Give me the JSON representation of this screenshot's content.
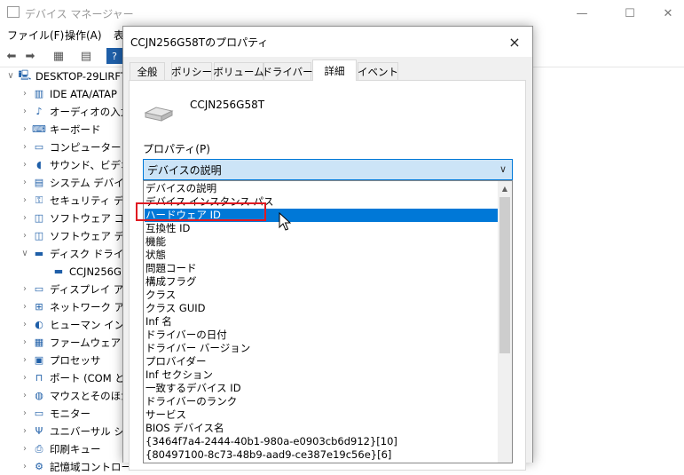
{
  "main_window": {
    "title": "デバイス マネージャー",
    "menu": [
      "ファイル(F)",
      "操作(A)",
      "表"
    ],
    "tree": [
      {
        "label": "DESKTOP-29LIRFT",
        "indent": 0,
        "expander": "v",
        "icon": "computer-icon"
      },
      {
        "label": "IDE ATA/ATAP",
        "indent": 1,
        "expander": ">",
        "icon": "ide-controller-icon"
      },
      {
        "label": "オーディオの入力",
        "indent": 1,
        "expander": ">",
        "icon": "audio-icon"
      },
      {
        "label": "キーボード",
        "indent": 1,
        "expander": ">",
        "icon": "keyboard-icon"
      },
      {
        "label": "コンピューター",
        "indent": 1,
        "expander": ">",
        "icon": "monitor-icon"
      },
      {
        "label": "サウンド、ビデオ、",
        "indent": 1,
        "expander": ">",
        "icon": "speaker-icon"
      },
      {
        "label": "システム デバイス",
        "indent": 1,
        "expander": ">",
        "icon": "system-device-icon"
      },
      {
        "label": "セキュリティ デバイ",
        "indent": 1,
        "expander": ">",
        "icon": "security-key-icon"
      },
      {
        "label": "ソフトウェア コンポ",
        "indent": 1,
        "expander": ">",
        "icon": "software-component-icon"
      },
      {
        "label": "ソフトウェア デバ",
        "indent": 1,
        "expander": ">",
        "icon": "software-device-icon"
      },
      {
        "label": "ディスク ドライブ",
        "indent": 1,
        "expander": "v",
        "icon": "disk-drive-icon"
      },
      {
        "label": "CCJN256G",
        "indent": 2,
        "expander": "",
        "icon": "disk-drive-icon"
      },
      {
        "label": "ディスプレイ アダ",
        "indent": 1,
        "expander": ">",
        "icon": "display-adapter-icon"
      },
      {
        "label": "ネットワーク アダ",
        "indent": 1,
        "expander": ">",
        "icon": "network-adapter-icon"
      },
      {
        "label": "ヒューマン インタ",
        "indent": 1,
        "expander": ">",
        "icon": "hid-icon"
      },
      {
        "label": "ファームウェア",
        "indent": 1,
        "expander": ">",
        "icon": "firmware-icon"
      },
      {
        "label": "プロセッサ",
        "indent": 1,
        "expander": ">",
        "icon": "processor-icon"
      },
      {
        "label": "ポート (COM と",
        "indent": 1,
        "expander": ">",
        "icon": "port-icon"
      },
      {
        "label": "マウスとそのほか",
        "indent": 1,
        "expander": ">",
        "icon": "mouse-icon"
      },
      {
        "label": "モニター",
        "indent": 1,
        "expander": ">",
        "icon": "monitor-icon"
      },
      {
        "label": "ユニバーサル シリ",
        "indent": 1,
        "expander": ">",
        "icon": "usb-icon"
      },
      {
        "label": "印刷キュー",
        "indent": 1,
        "expander": ">",
        "icon": "printer-icon"
      },
      {
        "label": "記憶域コントロー",
        "indent": 1,
        "expander": ">",
        "icon": "storage-controller-icon"
      }
    ]
  },
  "dialog": {
    "title": "CCJN256G58Tのプロパティ",
    "close_icon": "×",
    "tabs": [
      "全般",
      "ポリシー",
      "ボリューム",
      "ドライバー",
      "詳細",
      "イベント"
    ],
    "active_tab": "詳細",
    "device_name": "CCJN256G58T",
    "property_label": "プロパティ(P)",
    "property_selected": "デバイスの説明",
    "property_options": [
      "デバイスの説明",
      "デバイス インスタンス パス",
      "ハードウェア ID",
      "互換性 ID",
      "機能",
      "状態",
      "問題コード",
      "構成フラグ",
      "クラス",
      "クラス GUID",
      "Inf 名",
      "ドライバーの日付",
      "ドライバー バージョン",
      "プロバイダー",
      "Inf セクション",
      "一致するデバイス ID",
      "ドライバーのランク",
      "サービス",
      "BIOS デバイス名",
      "{3464f7a4-2444-40b1-980a-e0903cb6d912}[10]",
      "{80497100-8c73-48b9-aad9-ce387e19c56e}[6]"
    ],
    "highlighted_option": "ハードウェア ID"
  },
  "colors": {
    "selection": "#0078d7",
    "select_bg": "#cce4f7",
    "highlight_box": "#e01a22"
  }
}
